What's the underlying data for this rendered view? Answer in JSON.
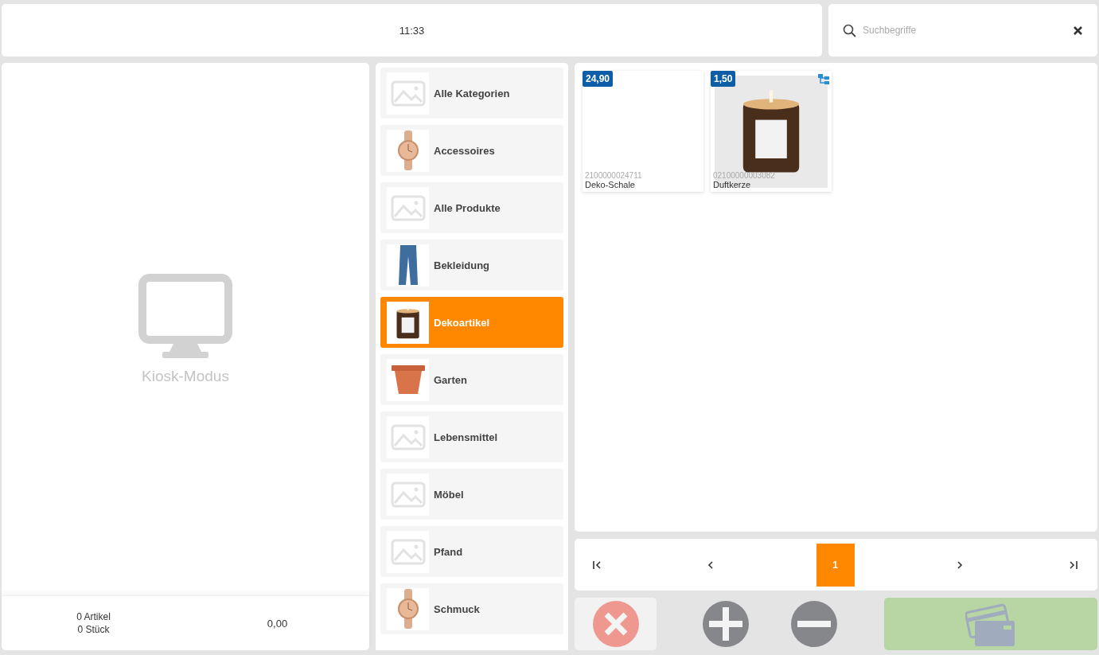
{
  "header": {
    "time": "11:33"
  },
  "search": {
    "placeholder": "Suchbegriffe"
  },
  "kiosk": {
    "label": "Kiosk-Modus"
  },
  "totals": {
    "articles": "0 Artikel",
    "pieces": "0 Stück",
    "sum": "0,00"
  },
  "categories": [
    {
      "label": "Alle Kategorien",
      "kind": "none",
      "selected": false
    },
    {
      "label": "Accessoires",
      "kind": "watch",
      "selected": false
    },
    {
      "label": "Alle Produkte",
      "kind": "none",
      "selected": false
    },
    {
      "label": "Bekleidung",
      "kind": "jeans",
      "selected": false
    },
    {
      "label": "Dekoartikel",
      "kind": "candle",
      "selected": true
    },
    {
      "label": "Garten",
      "kind": "pot",
      "selected": false
    },
    {
      "label": "Lebensmittel",
      "kind": "none",
      "selected": false
    },
    {
      "label": "Möbel",
      "kind": "none",
      "selected": false
    },
    {
      "label": "Pfand",
      "kind": "none",
      "selected": false
    },
    {
      "label": "Schmuck",
      "kind": "watch",
      "selected": false
    }
  ],
  "products": [
    {
      "price": "24,90",
      "code": "2100000024711",
      "name": "Deko-Schale",
      "kind": "none",
      "variants": false
    },
    {
      "price": "1,50",
      "code": "02100000003082",
      "name": "Duftkerze",
      "kind": "candle",
      "variants": true
    }
  ],
  "pagination": {
    "pages": [
      {
        "label": "1",
        "selected": true
      }
    ]
  }
}
